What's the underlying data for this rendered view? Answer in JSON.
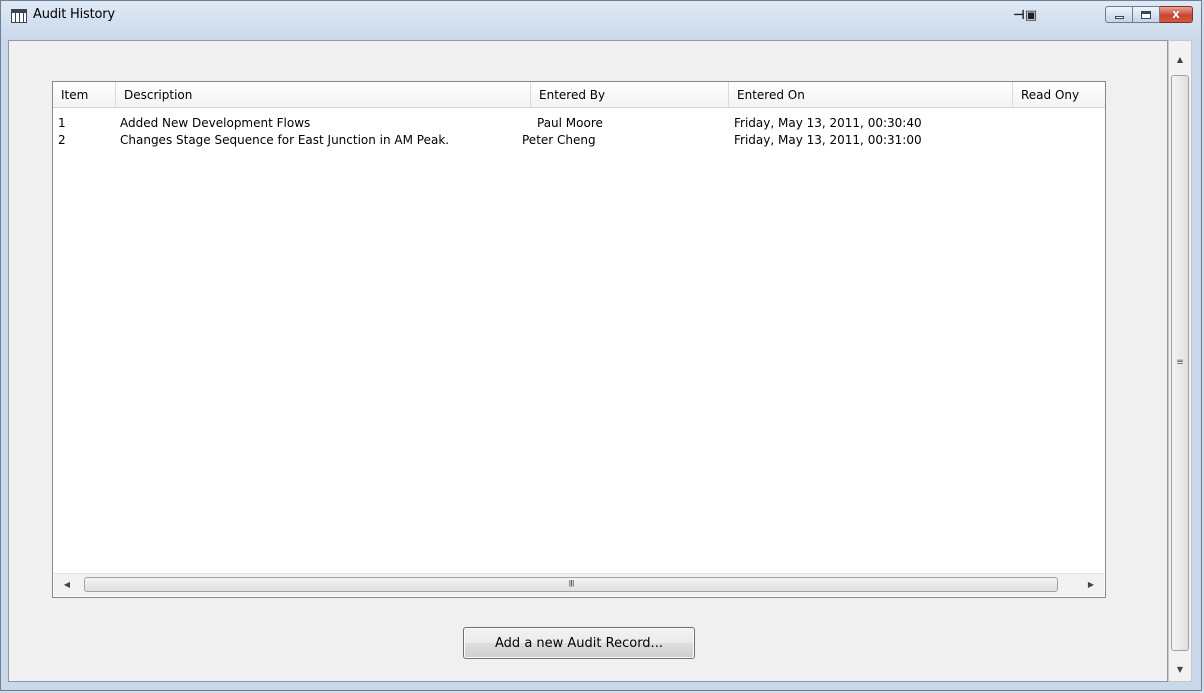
{
  "window": {
    "title": "Audit History",
    "close_glyph": "x"
  },
  "listview": {
    "columns": [
      "Item",
      "Description",
      "Entered By",
      "Entered On",
      "Read Ony"
    ],
    "rows": [
      [
        "1",
        "Added New Development Flows",
        "Paul Moore",
        "Friday, May 13, 2011, 00:30:40",
        ""
      ],
      [
        "2",
        "Changes Stage Sequence for East Junction in AM Peak.",
        "Peter Cheng",
        "Friday, May 13, 2011, 00:31:00",
        ""
      ]
    ]
  },
  "scrollbars": {
    "h_grip": "III",
    "v_grip": "≡"
  },
  "buttons": {
    "add_audit_record": "Add a new Audit Record..."
  },
  "icons": {
    "app": "table-icon",
    "pin": "pin-icon",
    "minimize": "minimize-icon",
    "maximize": "maximize-icon",
    "close": "close-icon"
  }
}
